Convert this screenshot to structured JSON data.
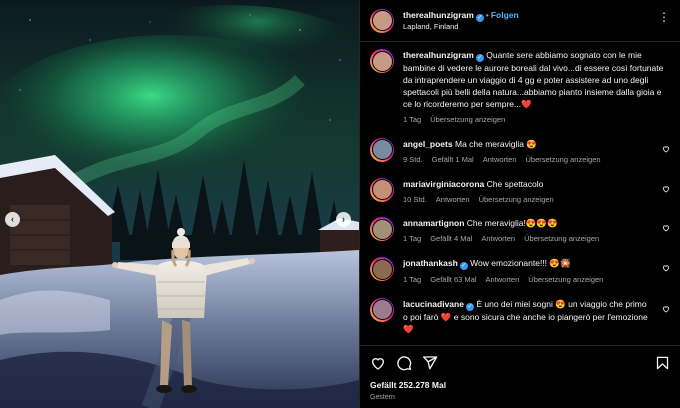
{
  "post": {
    "username": "therealhunzigram",
    "follow_label": "Folgen",
    "location": "Lapland, Finland",
    "caption": "Quante sere abbiamo sognato con le mie bambine di vedere le aurore boreali dal vivo...di essere così fortunate da intraprendere un viaggio di 4 gg e poter assistere ad uno degli spettacoli più belli della natura...abbiamo pianto insieme dalla gioia e ce lo ricorderemo per sempre...❤️",
    "caption_time": "1 Tag",
    "caption_translate": "Übersetzung anzeigen",
    "likes": "Gefällt 252.278 Mal",
    "date": "Gestern",
    "colors": {
      "accent": "#4cb5f9",
      "verified": "#3897f0",
      "muted": "#a8a8a8",
      "heart": "#ed4956"
    }
  },
  "comments": [
    {
      "user": "angel_poets",
      "verified": false,
      "text": "Ma che meraviglia 😍",
      "time": "9 Std.",
      "likes": "Gefällt 1 Mal",
      "reply": "Antworten",
      "translate": "Übersetzung anzeigen",
      "avatar": "#7a8aa0"
    },
    {
      "user": "mariavirginiacorona",
      "verified": false,
      "text": "Che spettacolo",
      "time": "10 Std.",
      "likes": "",
      "reply": "Antworten",
      "translate": "Übersetzung anzeigen",
      "avatar": "#c48f76"
    },
    {
      "user": "annamartignon",
      "verified": false,
      "text": "Che meraviglia!😍😍😍",
      "time": "1 Tag",
      "likes": "Gefällt 4 Mal",
      "reply": "Antworten",
      "translate": "Übersetzung anzeigen",
      "avatar": "#a09078"
    },
    {
      "user": "jonathankash",
      "verified": true,
      "text": "Wow emozionante!!! 😍🎇",
      "time": "1 Tag",
      "likes": "Gefällt 63 Mal",
      "reply": "Antworten",
      "translate": "Übersetzung anzeigen",
      "avatar": "#8b6a50"
    },
    {
      "user": "lacucinadivane",
      "verified": true,
      "text": "È uno dei miei sogni 😍 un viaggio che primo o poi farò ❤️ e sono sicura che anche io piangerò per l'emozione ❤️",
      "time": "",
      "likes": "",
      "reply": "",
      "translate": "",
      "avatar": "#9a7c8e"
    }
  ],
  "icons": {
    "more": "more-options-icon",
    "like": "heart-icon",
    "comment": "comment-icon",
    "share": "paper-plane-icon",
    "save": "bookmark-icon",
    "prev": "chevron-left-icon",
    "next": "chevron-right-icon"
  },
  "nav": {
    "prev": "‹",
    "next": "›"
  }
}
